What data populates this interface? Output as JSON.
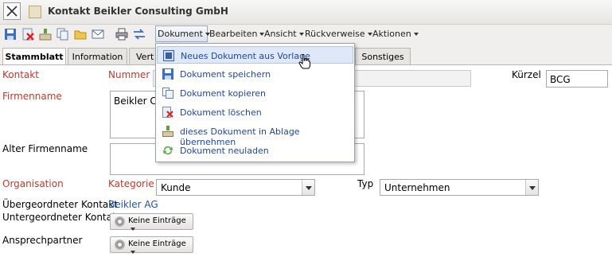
{
  "window": {
    "title": "Kontakt Beikler Consulting GmbH"
  },
  "menus": [
    {
      "label": "Dokument",
      "active": true
    },
    {
      "label": "Bearbeiten"
    },
    {
      "label": "Ansicht"
    },
    {
      "label": "Rückverweise"
    },
    {
      "label": "Aktionen"
    }
  ],
  "tabs": [
    {
      "label": "Stammblatt",
      "active": true
    },
    {
      "label": "Information"
    },
    {
      "label": "Vert"
    },
    {
      "label": "Sonstiges"
    }
  ],
  "dropdown": {
    "items": [
      {
        "label": "Neues Dokument aus Vorlage",
        "icon": "new-from-template-icon",
        "highlighted": true
      },
      {
        "label": "Dokument speichern",
        "icon": "save-icon"
      },
      {
        "label": "Dokument kopieren",
        "icon": "copy-icon"
      },
      {
        "label": "Dokument löschen",
        "icon": "delete-icon"
      },
      {
        "label": "dieses Dokument in Ablage übernehmen",
        "icon": "archive-icon"
      },
      {
        "label": "Dokument neuladen",
        "icon": "reload-icon"
      }
    ]
  },
  "form": {
    "kontakt_label": "Kontakt",
    "nummer_label": "Nummer",
    "kuerzel_label": "Kürzel",
    "kuerzel_value": "BCG",
    "firmenname_label": "Firmenname",
    "firmenname_value": "Beikler Co",
    "alter_firmenname_label": "Alter Firmenname",
    "organisation_label": "Organisation",
    "kategorie_label": "Kategorie",
    "kategorie_value": "Kunde",
    "typ_label": "Typ",
    "typ_value": "Unternehmen",
    "uebergeordneter_label": "Übergeordneter Kontakt",
    "uebergeordneter_value": "Beikler AG",
    "untergeordneter_label": "Untergeordneter Kontakt",
    "ansprechpartner_label": "Ansprechpartner",
    "keine_eintraege": "Keine Einträge"
  },
  "colors": {
    "required_label": "#c0392b",
    "link": "#2054a8",
    "menu_item": "#1f47a8",
    "highlight": "#dfe8f6"
  }
}
